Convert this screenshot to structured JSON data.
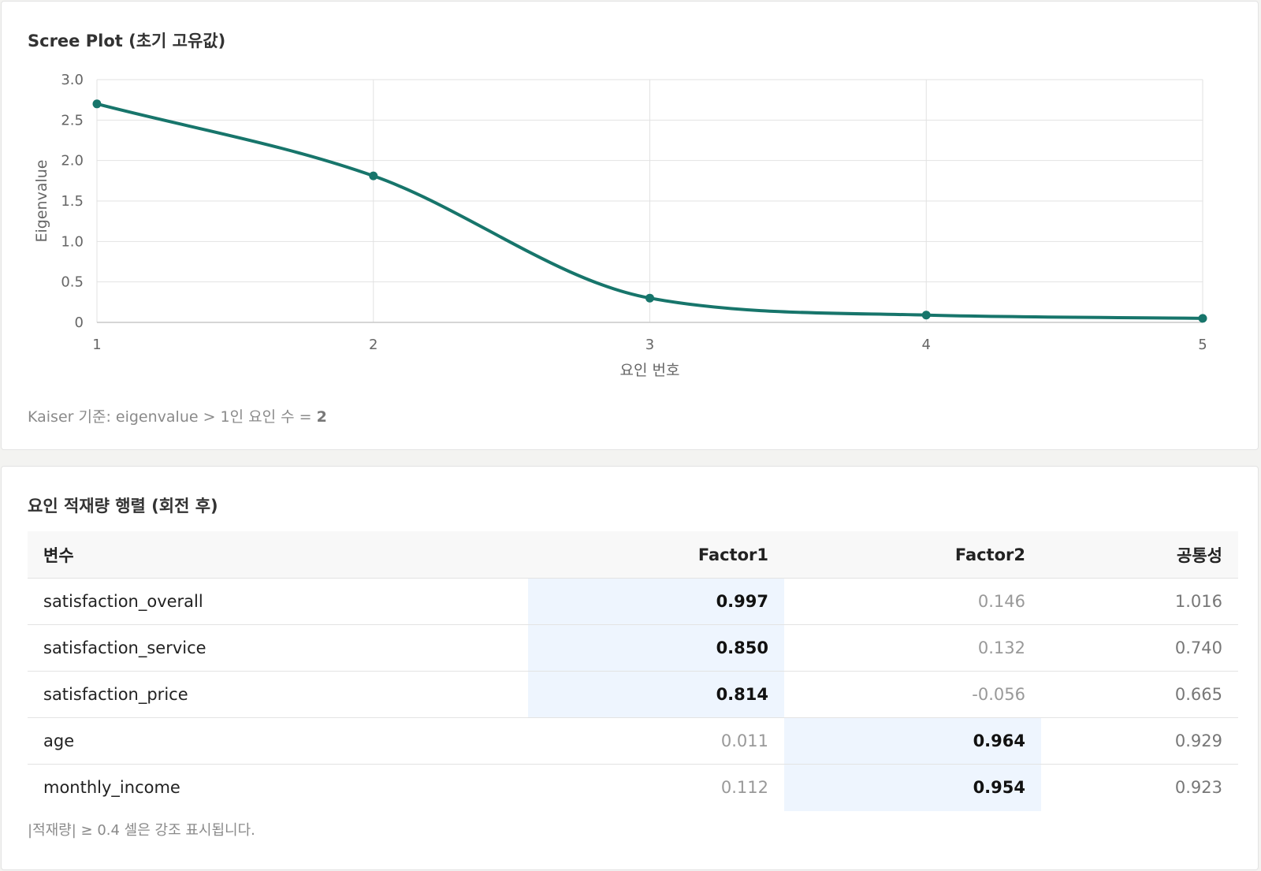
{
  "scree": {
    "title": "Scree Plot (초기 고유값)",
    "kaiser_label": "Kaiser 기준: eigenvalue > 1인 요인 수 = ",
    "kaiser_count": "2"
  },
  "chart_data": {
    "type": "line",
    "title": "Scree Plot (초기 고유값)",
    "xlabel": "요인 번호",
    "ylabel": "Eigenvalue",
    "x": [
      1,
      2,
      3,
      4,
      5
    ],
    "y": [
      2.7,
      1.81,
      0.3,
      0.09,
      0.05
    ],
    "xlim": [
      1,
      5
    ],
    "ylim": [
      0,
      3.0
    ],
    "yticks": [
      "0",
      "0.5",
      "1.0",
      "1.5",
      "2.0",
      "2.5",
      "3.0"
    ],
    "yticks_values": [
      0,
      0.5,
      1.0,
      1.5,
      2.0,
      2.5,
      3.0
    ],
    "xticks": [
      "1",
      "2",
      "3",
      "4",
      "5"
    ],
    "grid": true,
    "line_color": "#17756b",
    "smooth": true
  },
  "loadings": {
    "title": "요인 적재량 행렬 (회전 후)",
    "headers": {
      "variable": "변수",
      "factor1": "Factor1",
      "factor2": "Factor2",
      "communality": "공통성"
    },
    "rows": [
      {
        "variable": "satisfaction_overall",
        "factor1": "0.997",
        "factor2": "0.146",
        "communality": "1.016",
        "f1_high": true,
        "f2_high": false
      },
      {
        "variable": "satisfaction_service",
        "factor1": "0.850",
        "factor2": "0.132",
        "communality": "0.740",
        "f1_high": true,
        "f2_high": false
      },
      {
        "variable": "satisfaction_price",
        "factor1": "0.814",
        "factor2": "-0.056",
        "communality": "0.665",
        "f1_high": true,
        "f2_high": false
      },
      {
        "variable": "age",
        "factor1": "0.011",
        "factor2": "0.964",
        "communality": "0.929",
        "f1_high": false,
        "f2_high": true
      },
      {
        "variable": "monthly_income",
        "factor1": "0.112",
        "factor2": "0.954",
        "communality": "0.923",
        "f1_high": false,
        "f2_high": true
      }
    ],
    "footnote": "|적재량| ≥ 0.4 셀은 강조 표시됩니다.",
    "highlight_color": "#eef5fe"
  }
}
